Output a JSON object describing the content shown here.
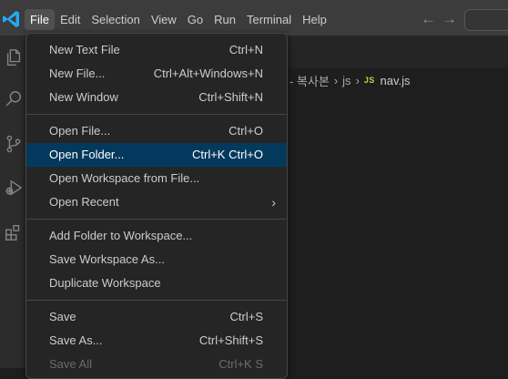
{
  "menubar": {
    "items": [
      "File",
      "Edit",
      "Selection",
      "View",
      "Go",
      "Run",
      "Terminal",
      "Help"
    ],
    "active_index": 0
  },
  "nav": {
    "back_icon": "arrow-left-icon",
    "forward_icon": "arrow-right-icon"
  },
  "colors": {
    "titlebar": "#3c3c3c",
    "menu_bg": "#252526",
    "selection": "#04395e",
    "accent_logo": "#23a9f2",
    "js_badge": "#cbcb41"
  },
  "breadcrumb": {
    "folder_partial": "- 복사본",
    "subfolder": "js",
    "file_badge": "JS",
    "file": "nav.js"
  },
  "file_menu": {
    "items": [
      {
        "label": "New Text File",
        "shortcut": "Ctrl+N"
      },
      {
        "label": "New File...",
        "shortcut": "Ctrl+Alt+Windows+N"
      },
      {
        "label": "New Window",
        "shortcut": "Ctrl+Shift+N"
      },
      {
        "label": "Open File...",
        "shortcut": "Ctrl+O"
      },
      {
        "label": "Open Folder...",
        "shortcut": "Ctrl+K Ctrl+O"
      },
      {
        "label": "Open Workspace from File...",
        "shortcut": ""
      },
      {
        "label": "Open Recent",
        "shortcut": ""
      },
      {
        "label": "Add Folder to Workspace...",
        "shortcut": ""
      },
      {
        "label": "Save Workspace As...",
        "shortcut": ""
      },
      {
        "label": "Duplicate Workspace",
        "shortcut": ""
      },
      {
        "label": "Save",
        "shortcut": "Ctrl+S"
      },
      {
        "label": "Save As...",
        "shortcut": "Ctrl+Shift+S"
      },
      {
        "label": "Save All",
        "shortcut": "Ctrl+K S"
      }
    ],
    "selected_index": 4
  },
  "activity_icons": [
    "explorer-icon",
    "search-icon",
    "source-control-icon",
    "run-debug-icon",
    "extensions-icon"
  ]
}
